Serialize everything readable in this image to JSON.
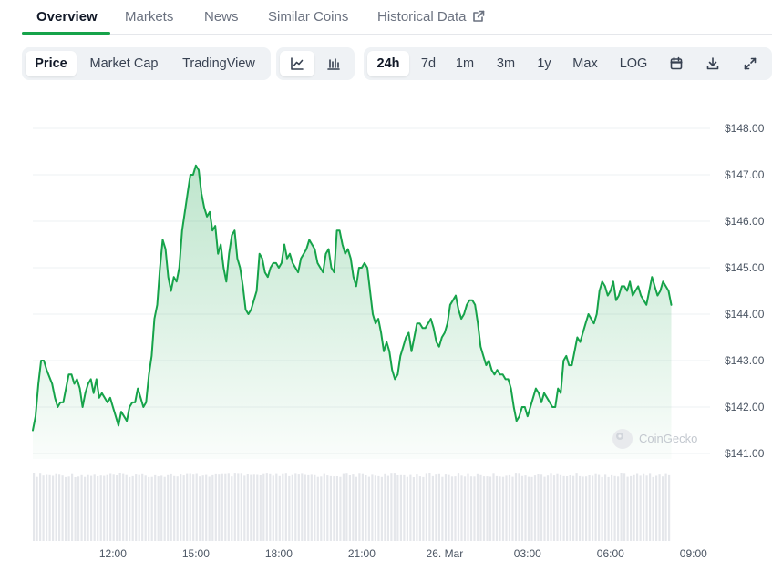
{
  "tabs": [
    {
      "label": "Overview",
      "active": true
    },
    {
      "label": "Markets"
    },
    {
      "label": "News"
    },
    {
      "label": "Similar Coins"
    },
    {
      "label": "Historical Data",
      "icon": "external-link-icon"
    }
  ],
  "metric_toggle": [
    "Price",
    "Market Cap",
    "TradingView"
  ],
  "chart_type_toggle": [
    "line-chart-icon",
    "candlestick-icon"
  ],
  "range_toggle": [
    "24h",
    "7d",
    "1m",
    "3m",
    "1y",
    "Max",
    "LOG"
  ],
  "tool_icons": [
    "calendar-icon",
    "download-icon",
    "fullscreen-icon"
  ],
  "watermark": "CoinGecko",
  "colors": {
    "line": "#16a34a",
    "fill": "#16a34a",
    "volume": "#e5e7eb",
    "grid": "#eef0f3"
  },
  "chart_data": {
    "type": "line",
    "y_prefix": "$",
    "ylim": [
      141,
      148
    ],
    "yticks": [
      "$148.00",
      "$147.00",
      "$146.00",
      "$145.00",
      "$144.00",
      "$143.00",
      "$142.00",
      "$141.00"
    ],
    "xlabels": [
      "12:00",
      "15:00",
      "18:00",
      "21:00",
      "26. Mar",
      "03:00",
      "06:00",
      "09:00"
    ],
    "xlabel_hours": [
      12,
      15,
      18,
      21,
      24,
      27,
      30,
      33
    ],
    "xlim_hours": [
      9.1,
      33.6
    ],
    "grid": true,
    "series": [
      {
        "points": [
          [
            9.1,
            141.5
          ],
          [
            9.2,
            141.8
          ],
          [
            9.3,
            142.5
          ],
          [
            9.4,
            143.0
          ],
          [
            9.5,
            143.0
          ],
          [
            9.6,
            142.8
          ],
          [
            9.8,
            142.5
          ],
          [
            9.9,
            142.2
          ],
          [
            10.0,
            142.0
          ],
          [
            10.1,
            142.1
          ],
          [
            10.2,
            142.1
          ],
          [
            10.3,
            142.4
          ],
          [
            10.4,
            142.7
          ],
          [
            10.5,
            142.7
          ],
          [
            10.6,
            142.5
          ],
          [
            10.7,
            142.6
          ],
          [
            10.8,
            142.4
          ],
          [
            10.9,
            142.0
          ],
          [
            11.0,
            142.3
          ],
          [
            11.1,
            142.5
          ],
          [
            11.2,
            142.6
          ],
          [
            11.3,
            142.3
          ],
          [
            11.4,
            142.6
          ],
          [
            11.5,
            142.2
          ],
          [
            11.6,
            142.3
          ],
          [
            11.7,
            142.2
          ],
          [
            11.8,
            142.1
          ],
          [
            11.9,
            142.2
          ],
          [
            12.0,
            142.0
          ],
          [
            12.1,
            141.8
          ],
          [
            12.2,
            141.6
          ],
          [
            12.3,
            141.9
          ],
          [
            12.4,
            141.8
          ],
          [
            12.5,
            141.7
          ],
          [
            12.6,
            142.0
          ],
          [
            12.7,
            142.1
          ],
          [
            12.8,
            142.1
          ],
          [
            12.9,
            142.4
          ],
          [
            13.0,
            142.2
          ],
          [
            13.1,
            142.0
          ],
          [
            13.2,
            142.1
          ],
          [
            13.3,
            142.7
          ],
          [
            13.4,
            143.1
          ],
          [
            13.5,
            143.9
          ],
          [
            13.6,
            144.2
          ],
          [
            13.7,
            145.0
          ],
          [
            13.8,
            145.6
          ],
          [
            13.9,
            145.4
          ],
          [
            14.0,
            144.8
          ],
          [
            14.1,
            144.5
          ],
          [
            14.2,
            144.8
          ],
          [
            14.3,
            144.7
          ],
          [
            14.4,
            145.0
          ],
          [
            14.5,
            145.8
          ],
          [
            14.6,
            146.2
          ],
          [
            14.7,
            146.6
          ],
          [
            14.8,
            147.0
          ],
          [
            14.9,
            147.0
          ],
          [
            15.0,
            147.2
          ],
          [
            15.1,
            147.1
          ],
          [
            15.2,
            146.6
          ],
          [
            15.3,
            146.3
          ],
          [
            15.4,
            146.1
          ],
          [
            15.5,
            146.2
          ],
          [
            15.6,
            145.8
          ],
          [
            15.7,
            145.9
          ],
          [
            15.8,
            145.3
          ],
          [
            15.9,
            145.5
          ],
          [
            16.0,
            145.0
          ],
          [
            16.1,
            144.7
          ],
          [
            16.2,
            145.3
          ],
          [
            16.3,
            145.7
          ],
          [
            16.4,
            145.8
          ],
          [
            16.5,
            145.2
          ],
          [
            16.6,
            145.0
          ],
          [
            16.7,
            144.6
          ],
          [
            16.8,
            144.1
          ],
          [
            16.9,
            144.0
          ],
          [
            17.0,
            144.1
          ],
          [
            17.1,
            144.3
          ],
          [
            17.2,
            144.5
          ],
          [
            17.3,
            145.3
          ],
          [
            17.4,
            145.2
          ],
          [
            17.5,
            144.9
          ],
          [
            17.6,
            144.8
          ],
          [
            17.7,
            145.0
          ],
          [
            17.8,
            145.1
          ],
          [
            17.9,
            145.1
          ],
          [
            18.0,
            145.0
          ],
          [
            18.1,
            145.1
          ],
          [
            18.2,
            145.5
          ],
          [
            18.3,
            145.2
          ],
          [
            18.4,
            145.3
          ],
          [
            18.5,
            145.1
          ],
          [
            18.6,
            145.0
          ],
          [
            18.7,
            144.9
          ],
          [
            18.8,
            145.2
          ],
          [
            18.9,
            145.3
          ],
          [
            19.0,
            145.4
          ],
          [
            19.1,
            145.6
          ],
          [
            19.2,
            145.5
          ],
          [
            19.3,
            145.4
          ],
          [
            19.4,
            145.1
          ],
          [
            19.5,
            145.0
          ],
          [
            19.6,
            144.9
          ],
          [
            19.7,
            145.3
          ],
          [
            19.8,
            145.4
          ],
          [
            19.9,
            145.0
          ],
          [
            20.0,
            144.9
          ],
          [
            20.1,
            145.8
          ],
          [
            20.2,
            145.8
          ],
          [
            20.3,
            145.5
          ],
          [
            20.4,
            145.3
          ],
          [
            20.5,
            145.4
          ],
          [
            20.6,
            145.2
          ],
          [
            20.7,
            144.8
          ],
          [
            20.8,
            144.6
          ],
          [
            20.9,
            145.0
          ],
          [
            21.0,
            145.0
          ],
          [
            21.1,
            145.1
          ],
          [
            21.2,
            145.0
          ],
          [
            21.3,
            144.5
          ],
          [
            21.4,
            144.0
          ],
          [
            21.5,
            143.8
          ],
          [
            21.6,
            143.9
          ],
          [
            21.7,
            143.6
          ],
          [
            21.8,
            143.2
          ],
          [
            21.9,
            143.4
          ],
          [
            22.0,
            143.2
          ],
          [
            22.1,
            142.8
          ],
          [
            22.2,
            142.6
          ],
          [
            22.3,
            142.7
          ],
          [
            22.4,
            143.1
          ],
          [
            22.5,
            143.3
          ],
          [
            22.6,
            143.5
          ],
          [
            22.7,
            143.6
          ],
          [
            22.8,
            143.2
          ],
          [
            22.9,
            143.5
          ],
          [
            23.0,
            143.8
          ],
          [
            23.1,
            143.8
          ],
          [
            23.2,
            143.7
          ],
          [
            23.3,
            143.7
          ],
          [
            23.4,
            143.8
          ],
          [
            23.5,
            143.9
          ],
          [
            23.6,
            143.7
          ],
          [
            23.7,
            143.4
          ],
          [
            23.8,
            143.3
          ],
          [
            23.9,
            143.5
          ],
          [
            24.0,
            143.6
          ],
          [
            24.1,
            143.8
          ],
          [
            24.2,
            144.2
          ],
          [
            24.3,
            144.3
          ],
          [
            24.4,
            144.4
          ],
          [
            24.5,
            144.1
          ],
          [
            24.6,
            143.9
          ],
          [
            24.7,
            144.0
          ],
          [
            24.8,
            144.2
          ],
          [
            24.9,
            144.3
          ],
          [
            25.0,
            144.3
          ],
          [
            25.1,
            144.2
          ],
          [
            25.2,
            143.8
          ],
          [
            25.3,
            143.3
          ],
          [
            25.4,
            143.1
          ],
          [
            25.5,
            142.9
          ],
          [
            25.6,
            143.0
          ],
          [
            25.7,
            142.8
          ],
          [
            25.8,
            142.7
          ],
          [
            25.9,
            142.8
          ],
          [
            26.0,
            142.7
          ],
          [
            26.1,
            142.7
          ],
          [
            26.2,
            142.6
          ],
          [
            26.3,
            142.6
          ],
          [
            26.4,
            142.4
          ],
          [
            26.5,
            142.0
          ],
          [
            26.6,
            141.7
          ],
          [
            26.7,
            141.8
          ],
          [
            26.8,
            142.0
          ],
          [
            26.9,
            142.0
          ],
          [
            27.0,
            141.8
          ],
          [
            27.1,
            142.0
          ],
          [
            27.2,
            142.2
          ],
          [
            27.3,
            142.4
          ],
          [
            27.4,
            142.3
          ],
          [
            27.5,
            142.1
          ],
          [
            27.6,
            142.3
          ],
          [
            27.7,
            142.2
          ],
          [
            27.8,
            142.1
          ],
          [
            27.9,
            142.0
          ],
          [
            28.0,
            142.0
          ],
          [
            28.1,
            142.4
          ],
          [
            28.2,
            142.3
          ],
          [
            28.3,
            143.0
          ],
          [
            28.4,
            143.1
          ],
          [
            28.5,
            142.9
          ],
          [
            28.6,
            142.9
          ],
          [
            28.7,
            143.2
          ],
          [
            28.8,
            143.5
          ],
          [
            28.9,
            143.4
          ],
          [
            29.0,
            143.6
          ],
          [
            29.1,
            143.8
          ],
          [
            29.2,
            144.0
          ],
          [
            29.3,
            143.9
          ],
          [
            29.4,
            143.8
          ],
          [
            29.5,
            144.0
          ],
          [
            29.6,
            144.5
          ],
          [
            29.7,
            144.7
          ],
          [
            29.8,
            144.6
          ],
          [
            29.9,
            144.4
          ],
          [
            30.0,
            144.5
          ],
          [
            30.1,
            144.7
          ],
          [
            30.2,
            144.3
          ],
          [
            30.3,
            144.4
          ],
          [
            30.4,
            144.6
          ],
          [
            30.5,
            144.6
          ],
          [
            30.6,
            144.5
          ],
          [
            30.7,
            144.7
          ],
          [
            30.8,
            144.4
          ],
          [
            30.9,
            144.5
          ],
          [
            31.0,
            144.6
          ],
          [
            31.1,
            144.4
          ],
          [
            31.2,
            144.3
          ],
          [
            31.3,
            144.2
          ],
          [
            31.4,
            144.5
          ],
          [
            31.5,
            144.8
          ],
          [
            31.6,
            144.6
          ],
          [
            31.7,
            144.4
          ],
          [
            31.8,
            144.5
          ],
          [
            31.9,
            144.7
          ],
          [
            32.0,
            144.6
          ],
          [
            32.1,
            144.5
          ],
          [
            32.2,
            144.2
          ]
        ]
      }
    ]
  }
}
